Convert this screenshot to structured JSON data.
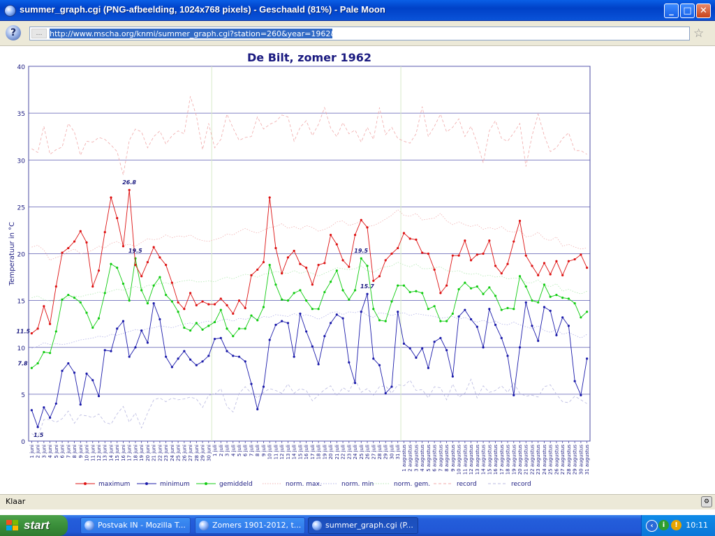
{
  "window": {
    "title": "summer_graph.cgi (PNG-afbeelding, 1024x768 pixels) - Geschaald (81%) - Pale Moon",
    "min_label": "_",
    "max_label": "□",
    "close_label": "✕"
  },
  "navbar": {
    "help_label": "?",
    "url": "http://www.mscha.org/knmi/summer_graph.cgi?station=260&year=1962&month=0",
    "star_label": "☆"
  },
  "status": {
    "text": "Klaar"
  },
  "taskbar": {
    "start_label": "start",
    "tasks": [
      "Postvak IN - Mozilla T...",
      "Zomers 1901-2012, t...",
      "summer_graph.cgi (P..."
    ],
    "clock": "10:11"
  },
  "chart_data": {
    "type": "line",
    "title": "De Bilt, zomer 1962",
    "ylabel": "Temperatuur in °C",
    "xlabel": "",
    "ylim": [
      0,
      40
    ],
    "yticks": [
      0,
      5,
      10,
      15,
      20,
      25,
      30,
      35,
      40
    ],
    "grid": true,
    "legend_placement": "bottom",
    "categories": [
      "1 juni",
      "2 juni",
      "3 juni",
      "4 juni",
      "5 juni",
      "6 juni",
      "7 juni",
      "8 juni",
      "9 juni",
      "10 juni",
      "11 juni",
      "12 juni",
      "13 juni",
      "14 juni",
      "15 juni",
      "16 juni",
      "17 juni",
      "18 juni",
      "19 juni",
      "20 juni",
      "21 juni",
      "22 juni",
      "23 juni",
      "24 juni",
      "25 juni",
      "26 juni",
      "27 juni",
      "28 juni",
      "29 juni",
      "30 juni",
      "1 juli",
      "2 juli",
      "3 juli",
      "4 juli",
      "5 juli",
      "6 juli",
      "7 juli",
      "8 juli",
      "9 juli",
      "10 juli",
      "11 juli",
      "12 juli",
      "13 juli",
      "14 juli",
      "15 juli",
      "16 juli",
      "17 juli",
      "18 juli",
      "19 juli",
      "20 juli",
      "21 juli",
      "22 juli",
      "23 juli",
      "24 juli",
      "25 juli",
      "26 juli",
      "27 juli",
      "28 juli",
      "29 juli",
      "30 juli",
      "31 juli",
      "1 augustus",
      "2 augustus",
      "3 augustus",
      "4 augustus",
      "5 augustus",
      "6 augustus",
      "7 augustus",
      "8 augustus",
      "9 augustus",
      "10 augustus",
      "11 augustus",
      "12 augustus",
      "13 augustus",
      "14 augustus",
      "15 augustus",
      "16 augustus",
      "17 augustus",
      "18 augustus",
      "19 augustus",
      "20 augustus",
      "21 augustus",
      "22 augustus",
      "23 augustus",
      "24 augustus",
      "25 augustus",
      "26 augustus",
      "27 augustus",
      "28 augustus",
      "29 augustus",
      "30 augustus",
      "31 augustus"
    ],
    "series": [
      {
        "name": "maximum",
        "color": "#dd1111",
        "style": "solid",
        "marker": true,
        "values": [
          11.5,
          12.0,
          14.4,
          12.5,
          16.5,
          20.1,
          20.6,
          21.3,
          22.4,
          21.2,
          16.5,
          18.2,
          22.3,
          26.0,
          23.8,
          20.8,
          26.8,
          18.8,
          17.6,
          19.1,
          20.7,
          19.6,
          18.8,
          16.9,
          14.8,
          14.1,
          15.8,
          14.5,
          14.9,
          14.6,
          14.6,
          15.2,
          14.5,
          13.6,
          15.0,
          14.2,
          17.7,
          18.3,
          19.1,
          26.0,
          20.6,
          17.9,
          19.6,
          20.3,
          18.9,
          18.5,
          16.7,
          18.8,
          19.0,
          22.0,
          21.0,
          19.3,
          18.6,
          22.0,
          23.6,
          22.8,
          17.1,
          17.6,
          19.3,
          20.0,
          20.6,
          22.2,
          21.6,
          21.5,
          20.1,
          20.0,
          18.3,
          15.8,
          16.6,
          19.8,
          19.8,
          21.4,
          19.3,
          19.9,
          20.0,
          21.4,
          18.7,
          17.9,
          18.9,
          21.3,
          23.5,
          19.8,
          18.7,
          17.7,
          19.0,
          17.8,
          19.2,
          17.7,
          19.2,
          19.4,
          19.9,
          18.5
        ]
      },
      {
        "name": "minimum",
        "color": "#1a1aaa",
        "style": "solid",
        "marker": true,
        "values": [
          3.3,
          1.5,
          3.6,
          2.5,
          4.0,
          7.5,
          8.3,
          7.3,
          3.9,
          7.2,
          6.5,
          4.8,
          9.7,
          9.6,
          12.0,
          12.8,
          9.0,
          10.0,
          11.8,
          10.5,
          14.7,
          13.0,
          9.0,
          7.9,
          8.8,
          9.6,
          8.7,
          8.1,
          8.5,
          9.1,
          10.9,
          11.0,
          9.6,
          9.1,
          9.0,
          8.5,
          6.1,
          3.4,
          5.8,
          10.8,
          12.4,
          12.8,
          12.6,
          9.0,
          13.6,
          11.7,
          10.1,
          8.2,
          11.2,
          12.6,
          13.5,
          13.1,
          8.4,
          6.2,
          13.8,
          15.7,
          8.8,
          8.1,
          5.1,
          5.8,
          13.8,
          10.4,
          9.9,
          8.9,
          9.9,
          7.8,
          10.6,
          11.0,
          9.7,
          6.9,
          13.3,
          14.0,
          13.0,
          12.2,
          10.0,
          14.1,
          12.4,
          11.0,
          9.1,
          4.9,
          10.0,
          14.8,
          12.3,
          10.7,
          14.3,
          13.9,
          11.3,
          13.2,
          12.3,
          6.4,
          4.9,
          8.8
        ]
      },
      {
        "name": "gemiddeld",
        "color": "#11cc11",
        "style": "solid",
        "marker": true,
        "values": [
          7.8,
          8.3,
          9.5,
          9.4,
          11.7,
          15.1,
          15.6,
          15.3,
          14.8,
          13.7,
          12.1,
          13.1,
          15.8,
          18.9,
          18.5,
          16.8,
          15.0,
          19.5,
          16.1,
          14.7,
          16.6,
          17.5,
          15.6,
          14.9,
          13.8,
          12.1,
          11.8,
          12.6,
          11.9,
          12.3,
          12.7,
          14.0,
          12.0,
          11.2,
          12.0,
          12.0,
          13.4,
          12.9,
          14.3,
          18.8,
          16.7,
          15.1,
          15.0,
          15.8,
          16.1,
          15.0,
          14.1,
          14.1,
          15.9,
          17.0,
          18.2,
          16.1,
          15.1,
          16.1,
          19.5,
          18.7,
          14.1,
          12.9,
          12.8,
          14.9,
          16.6,
          16.6,
          15.9,
          16.0,
          15.8,
          14.1,
          14.4,
          12.8,
          12.8,
          13.6,
          16.2,
          16.9,
          16.3,
          16.5,
          15.7,
          16.4,
          15.5,
          14.0,
          14.2,
          14.1,
          17.6,
          16.5,
          15.0,
          14.8,
          16.7,
          15.4,
          15.6,
          15.3,
          15.2,
          14.7,
          13.2,
          13.8
        ]
      },
      {
        "name": "norm. max.",
        "color": "#f0b0b0",
        "style": "dotted",
        "marker": false,
        "values": [
          20.7,
          20.9,
          20.4,
          19.3,
          19.6,
          19.8,
          20.2,
          20.5,
          20.0,
          20.1,
          20.4,
          20.8,
          20.6,
          21.1,
          21.3,
          20.9,
          21.0,
          20.8,
          21.2,
          21.6,
          21.5,
          21.6,
          22.0,
          21.7,
          21.9,
          21.8,
          22.0,
          21.6,
          21.4,
          21.3,
          21.5,
          21.7,
          22.1,
          22.0,
          22.4,
          22.7,
          22.4,
          22.2,
          22.5,
          22.8,
          22.9,
          23.2,
          22.7,
          22.9,
          22.6,
          23.0,
          22.8,
          22.4,
          22.6,
          22.9,
          23.4,
          23.5,
          23.0,
          23.2,
          23.5,
          22.9,
          23.0,
          23.3,
          23.7,
          24.1,
          24.7,
          24.1,
          24.0,
          24.3,
          23.6,
          23.7,
          23.8,
          24.3,
          23.5,
          23.1,
          23.4,
          23.1,
          22.9,
          23.1,
          22.6,
          22.8,
          22.6,
          22.9,
          22.4,
          22.3,
          22.5,
          21.8,
          21.9,
          22.3,
          21.6,
          21.4,
          21.8,
          20.8,
          21.0,
          20.7,
          20.5,
          20.6
        ]
      },
      {
        "name": "norm. min",
        "color": "#b0b0e8",
        "style": "dotted",
        "marker": false,
        "values": [
          9.9,
          10.1,
          10.5,
          10.3,
          10.4,
          10.3,
          10.4,
          10.6,
          10.8,
          10.9,
          11.0,
          11.2,
          11.1,
          11.4,
          11.3,
          11.5,
          11.7,
          11.9,
          11.8,
          12.0,
          12.1,
          12.3,
          12.2,
          12.1,
          12.3,
          12.5,
          12.6,
          12.4,
          12.7,
          12.8,
          12.6,
          12.9,
          13.0,
          12.8,
          13.1,
          13.0,
          13.2,
          13.0,
          13.3,
          13.2,
          13.5,
          13.4,
          13.3,
          13.6,
          13.3,
          13.5,
          13.3,
          13.0,
          13.3,
          13.7,
          13.8,
          13.5,
          13.8,
          13.7,
          13.9,
          13.4,
          13.2,
          13.7,
          13.6,
          13.4,
          13.6,
          13.7,
          13.4,
          13.6,
          13.5,
          13.4,
          13.3,
          13.1,
          13.2,
          13.3,
          13.0,
          13.2,
          12.9,
          12.7,
          12.9,
          12.6,
          12.8,
          12.5,
          12.4,
          12.7,
          12.4,
          12.2,
          12.0,
          12.3,
          11.8,
          11.6,
          11.9,
          11.4,
          11.6,
          11.3,
          11.0,
          11.4
        ]
      },
      {
        "name": "norm. gem.",
        "color": "#b0e8b0",
        "style": "dotted",
        "marker": false,
        "values": [
          15.3,
          15.5,
          15.1,
          14.9,
          15.0,
          15.1,
          15.3,
          15.5,
          15.4,
          15.6,
          15.7,
          15.9,
          15.8,
          16.0,
          16.2,
          16.1,
          16.3,
          16.5,
          16.3,
          16.6,
          16.7,
          16.8,
          16.9,
          16.7,
          17.0,
          17.1,
          17.2,
          17.0,
          17.0,
          17.1,
          17.0,
          17.3,
          17.5,
          17.3,
          17.6,
          17.8,
          17.7,
          17.5,
          17.8,
          17.9,
          18.1,
          18.0,
          17.9,
          18.2,
          17.9,
          18.1,
          17.9,
          17.6,
          17.9,
          18.2,
          18.5,
          18.4,
          18.3,
          18.4,
          18.7,
          18.2,
          18.0,
          18.4,
          18.6,
          18.7,
          19.1,
          18.8,
          18.6,
          18.9,
          18.4,
          18.4,
          18.5,
          18.6,
          18.2,
          18.1,
          18.2,
          17.9,
          17.8,
          17.9,
          17.6,
          17.7,
          17.5,
          17.6,
          17.3,
          17.4,
          17.4,
          16.9,
          16.9,
          17.2,
          16.6,
          16.5,
          16.8,
          16.0,
          16.2,
          15.9,
          15.7,
          16.0
        ]
      },
      {
        "name": "record",
        "color": "#f0a8a8",
        "style": "dashed",
        "marker": false,
        "values": [
          31.2,
          30.8,
          33.6,
          30.6,
          31.1,
          31.4,
          33.9,
          33.0,
          30.5,
          32.0,
          31.9,
          32.4,
          32.2,
          31.6,
          30.9,
          28.4,
          32.1,
          33.3,
          33.0,
          31.3,
          32.5,
          33.1,
          31.7,
          32.6,
          33.1,
          32.8,
          36.8,
          34.7,
          31.1,
          33.9,
          31.3,
          32.2,
          34.9,
          33.4,
          32.1,
          32.4,
          32.5,
          34.6,
          33.3,
          33.8,
          34.1,
          34.8,
          34.6,
          32.0,
          33.5,
          34.2,
          32.6,
          33.8,
          35.6,
          33.4,
          32.5,
          34.0,
          32.8,
          33.2,
          31.9,
          33.5,
          32.2,
          35.6,
          32.7,
          33.5,
          32.3,
          32.0,
          31.8,
          32.8,
          35.7,
          32.5,
          33.6,
          34.9,
          33.0,
          33.5,
          34.4,
          32.5,
          33.6,
          31.8,
          29.7,
          33.1,
          34.2,
          32.3,
          32.0,
          32.9,
          33.9,
          29.3,
          32.6,
          34.9,
          32.6,
          30.9,
          31.3,
          32.3,
          32.9,
          31.0,
          31.0,
          30.6
        ]
      },
      {
        "name": "record",
        "color": "#b8b8e0",
        "style": "dashed",
        "marker": false,
        "values": [
          0.8,
          0.4,
          2.3,
          2.3,
          2.0,
          2.4,
          3.2,
          1.9,
          2.8,
          2.7,
          2.5,
          2.9,
          2.0,
          1.8,
          2.9,
          3.7,
          2.0,
          3.0,
          1.4,
          3.0,
          4.4,
          4.6,
          4.2,
          4.6,
          4.4,
          4.5,
          4.7,
          4.5,
          3.6,
          4.9,
          5.0,
          5.6,
          3.7,
          3.1,
          5.1,
          5.8,
          5.1,
          4.6,
          5.2,
          5.6,
          5.4,
          5.1,
          6.1,
          5.1,
          5.6,
          5.4,
          4.3,
          4.9,
          5.5,
          5.9,
          4.8,
          5.7,
          5.3,
          6.6,
          5.2,
          5.6,
          4.9,
          5.8,
          5.9,
          5.1,
          6.0,
          5.9,
          6.5,
          5.4,
          5.5,
          4.6,
          5.8,
          5.7,
          4.4,
          6.1,
          4.7,
          5.1,
          6.6,
          4.6,
          5.9,
          5.2,
          5.4,
          5.9,
          5.2,
          6.2,
          5.1,
          4.8,
          4.9,
          4.7,
          5.8,
          6.0,
          5.0,
          4.2,
          4.1,
          4.8,
          4.4,
          4.0
        ]
      }
    ],
    "annotations": [
      {
        "series": "maximum",
        "index": 0,
        "label": "11.5",
        "dx": -22,
        "dy": 0
      },
      {
        "series": "maximum",
        "index": 16,
        "label": "26.8",
        "dx": -10,
        "dy": -8
      },
      {
        "series": "gemiddeld",
        "index": 0,
        "label": "7.8",
        "dx": -20,
        "dy": -4
      },
      {
        "series": "gemiddeld",
        "index": 17,
        "label": "19.5",
        "dx": -10,
        "dy": -8
      },
      {
        "series": "gemiddeld",
        "index": 54,
        "label": "19.5",
        "dx": -10,
        "dy": -8
      },
      {
        "series": "minimum",
        "index": 1,
        "label": "1.5",
        "dx": -6,
        "dy": 14
      },
      {
        "series": "minimum",
        "index": 55,
        "label": "15.7",
        "dx": -10,
        "dy": -8
      }
    ]
  }
}
